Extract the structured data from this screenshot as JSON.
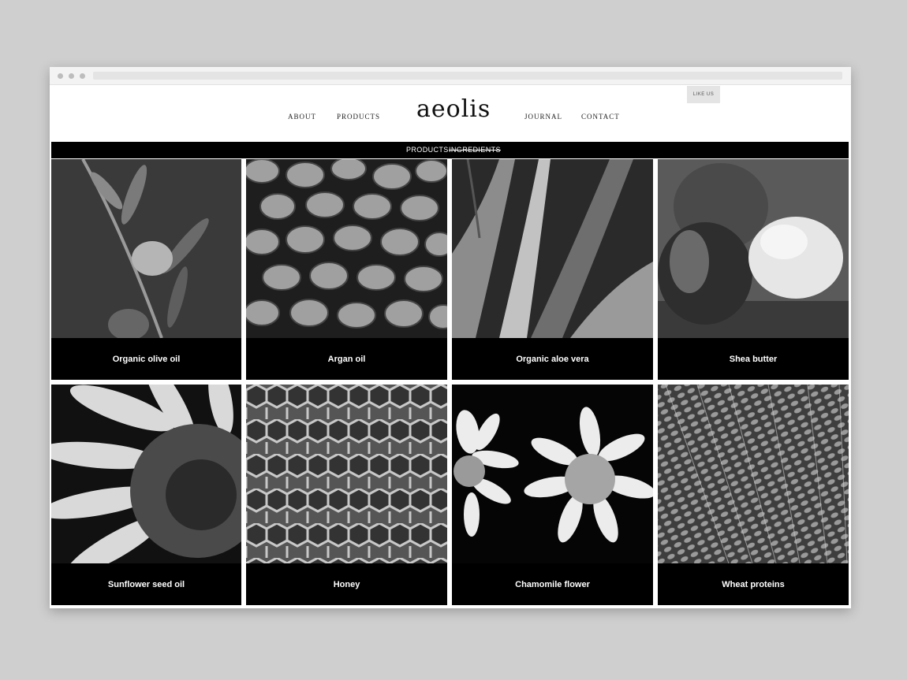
{
  "browser": {
    "window_controls": [
      "close",
      "minimize",
      "maximize"
    ]
  },
  "header": {
    "logo": "aeolis",
    "nav": {
      "about": "ABOUT",
      "products": "PRODUCTS",
      "journal": "JOURNAL",
      "contact": "CONTACT"
    },
    "like_button": "LIKE US"
  },
  "subnav": {
    "products": "PRODUCTS",
    "ingredients": "INGREDIENTS",
    "active": "INGREDIENTS"
  },
  "ingredients": [
    {
      "name": "Organic olive oil",
      "image_icon": "olive-branch-icon"
    },
    {
      "name": "Argan oil",
      "image_icon": "argan-nuts-icon"
    },
    {
      "name": "Organic aloe vera",
      "image_icon": "aloe-leaves-icon"
    },
    {
      "name": "Shea butter",
      "image_icon": "shea-butter-icon"
    },
    {
      "name": "Sunflower seed oil",
      "image_icon": "sunflower-icon"
    },
    {
      "name": "Honey",
      "image_icon": "honeycomb-icon"
    },
    {
      "name": "Chamomile flower",
      "image_icon": "chamomile-icon"
    },
    {
      "name": "Wheat proteins",
      "image_icon": "wheat-icon"
    }
  ],
  "colors": {
    "page_background": "#cfcfcf",
    "bar": "#000000",
    "text_on_dark": "#ffffff"
  }
}
